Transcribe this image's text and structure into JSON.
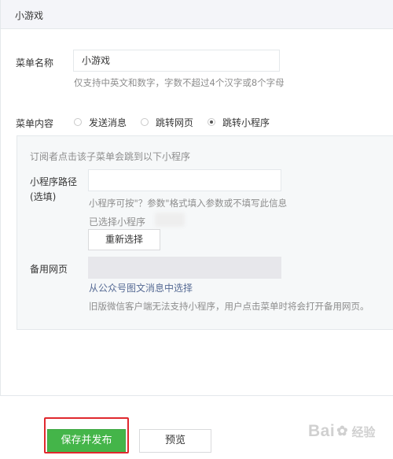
{
  "panel": {
    "title": "小游戏"
  },
  "menu_name": {
    "label": "菜单名称",
    "value": "小游戏",
    "tip": "仅支持中英文和数字，字数不超过4个汉字或8个字母"
  },
  "menu_content": {
    "label": "菜单内容",
    "options": [
      {
        "label": "发送消息",
        "checked": false
      },
      {
        "label": "跳转网页",
        "checked": false
      },
      {
        "label": "跳转小程序",
        "checked": true
      }
    ]
  },
  "mini_program": {
    "intro": "订阅者点击该子菜单会跳到以下小程序",
    "path_label_line1": "小程序路径",
    "path_label_line2": "(选填)",
    "path_value": "",
    "path_tip": "小程序可按\"？参数\"格式填入参数或不填写此信息",
    "selected_label": "已选择小程序",
    "reselect_button": "重新选择",
    "backup_label": "备用网页",
    "backup_value": "",
    "backup_link": "从公众号图文消息中选择",
    "backup_tip": "旧版微信客户端无法支持小程序，用户点击菜单时将会打开备用网页。"
  },
  "footer": {
    "publish_button": "保存并发布",
    "preview_button": "预览"
  },
  "watermark": {
    "text_a": "Bai",
    "text_b": "经验",
    "paw": "✿"
  },
  "colors": {
    "accent_green": "#44b549",
    "link_blue": "#576b95",
    "highlight_red": "#e0282e"
  }
}
